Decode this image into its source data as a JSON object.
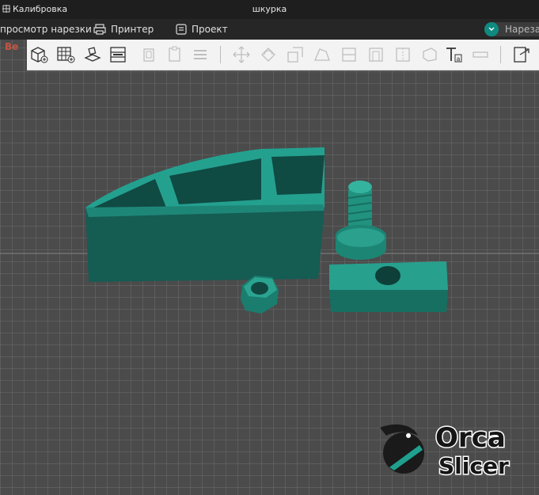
{
  "window": {
    "app_title": "Калибровка",
    "document_title": "шкурка"
  },
  "tabs": [
    {
      "label": "просмотр нарезки",
      "icon": "slice-preview-icon"
    },
    {
      "label": "Принтер",
      "icon": "printer-icon"
    },
    {
      "label": "Проект",
      "icon": "project-icon"
    }
  ],
  "slice_button": {
    "label": "Нареза",
    "icon": "chevron-down-icon"
  },
  "toolbar": {
    "icons": [
      "add-cube-icon",
      "add-plate-icon",
      "arrange-icon",
      "plate-settings-icon",
      "copy-icon",
      "paste-icon",
      "layers-icon",
      "move-icon",
      "rotate-icon",
      "scale-icon",
      "lay-on-face-icon",
      "cut-icon",
      "support-paint-icon",
      "seam-paint-icon",
      "color-paint-icon",
      "measure-icon",
      "text-icon",
      "assembly-icon",
      "export-icon"
    ]
  },
  "logo": {
    "line1": "Orca",
    "line2": "Slicer"
  },
  "colors": {
    "accent": "#0f8a80",
    "model": "#1f8e7f",
    "bed": "#4a4a4a",
    "grid": "#6b6b6b"
  }
}
